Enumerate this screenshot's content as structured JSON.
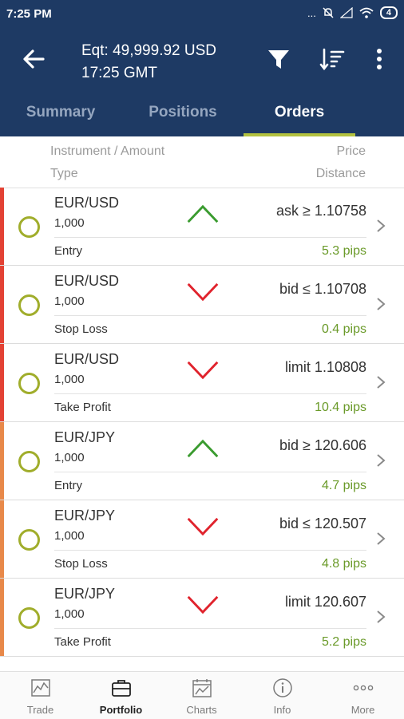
{
  "status_bar": {
    "time": "7:25 PM",
    "signal": "...",
    "battery": "4"
  },
  "header": {
    "equity_line": "Eqt: 49,999.92 USD",
    "time_line": "17:25 GMT"
  },
  "tabs": [
    {
      "label": "Summary",
      "active": false
    },
    {
      "label": "Positions",
      "active": false
    },
    {
      "label": "Orders",
      "active": true
    }
  ],
  "columns": {
    "instrument_amount": "Instrument / Amount",
    "type": "Type",
    "price": "Price",
    "distance": "Distance"
  },
  "orders": [
    {
      "instrument": "EUR/USD",
      "amount": "1,000",
      "type": "Entry",
      "direction": "up",
      "price": "ask ≥ 1.10758",
      "distance": "5.3  pips",
      "bar_color": "#e34234"
    },
    {
      "instrument": "EUR/USD",
      "amount": "1,000",
      "type": "Stop Loss",
      "direction": "down",
      "price": "bid ≤ 1.10708",
      "distance": "0.4  pips",
      "bar_color": "#e34234"
    },
    {
      "instrument": "EUR/USD",
      "amount": "1,000",
      "type": "Take Profit",
      "direction": "down",
      "price": "limit 1.10808",
      "distance": "10.4  pips",
      "bar_color": "#e34234"
    },
    {
      "instrument": "EUR/JPY",
      "amount": "1,000",
      "type": "Entry",
      "direction": "up",
      "price": "bid ≥ 120.606",
      "distance": "4.7  pips",
      "bar_color": "#e8894a"
    },
    {
      "instrument": "EUR/JPY",
      "amount": "1,000",
      "type": "Stop Loss",
      "direction": "down",
      "price": "bid ≤ 120.507",
      "distance": "4.8  pips",
      "bar_color": "#e8894a"
    },
    {
      "instrument": "EUR/JPY",
      "amount": "1,000",
      "type": "Take Profit",
      "direction": "down",
      "price": "limit 120.607",
      "distance": "5.2  pips",
      "bar_color": "#e8894a"
    }
  ],
  "bottom_nav": [
    {
      "label": "Trade",
      "icon": "trade-chart-icon",
      "active": false
    },
    {
      "label": "Portfolio",
      "icon": "briefcase-icon",
      "active": true
    },
    {
      "label": "Charts",
      "icon": "calendar-chart-icon",
      "active": false
    },
    {
      "label": "Info",
      "icon": "info-icon",
      "active": false
    },
    {
      "label": "More",
      "icon": "more-dots-icon",
      "active": false
    }
  ],
  "colors": {
    "header_bg": "#1e3a64",
    "tab_indicator": "#b3c23f",
    "up": "#3a9b2f",
    "down": "#e0232d",
    "distance": "#6a9a29",
    "circle": "#a0ad2b"
  }
}
